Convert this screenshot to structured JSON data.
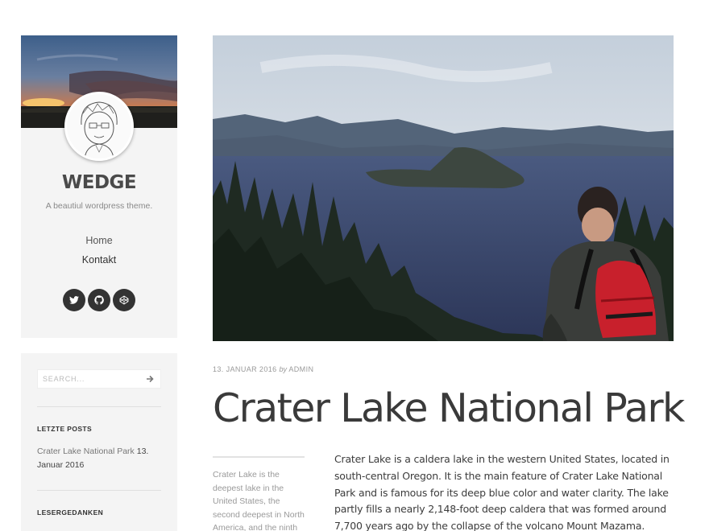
{
  "site": {
    "title": "WEDGE",
    "tagline": "A beautiul wordpress theme."
  },
  "nav": {
    "items": [
      {
        "label": "Home"
      },
      {
        "label": "Kontakt"
      }
    ]
  },
  "social": {
    "icons": [
      "twitter-icon",
      "github-icon",
      "codepen-icon"
    ]
  },
  "search": {
    "placeholder": "SEARCH..."
  },
  "widgets": {
    "recent_posts_title": "LETZTE POSTS",
    "recent_post_link": "Crater Lake National Park",
    "recent_post_date": "13. Januar 2016",
    "comments_title": "LESERGEDANKEN"
  },
  "post": {
    "date": "13. JANUAR 2016",
    "by": "by",
    "author": "ADMIN",
    "title": "Crater Lake National Park",
    "pull_quote": "Crater Lake is the deepest lake in the United States, the second deepest in North America, and the ninth",
    "body": "Crater Lake is a caldera lake in the western United States, located in south-central Oregon. It is the main feature of Crater Lake National Park and is famous for its deep blue color and water clarity. The lake partly fills a nearly 2,148-foot deep caldera that was formed around 7,700 years ago by the collapse of the volcano Mount Mazama."
  },
  "colors": {
    "card_background": "#f4f4f4",
    "social_button": "#333333",
    "backpack_red": "#c8202c"
  }
}
